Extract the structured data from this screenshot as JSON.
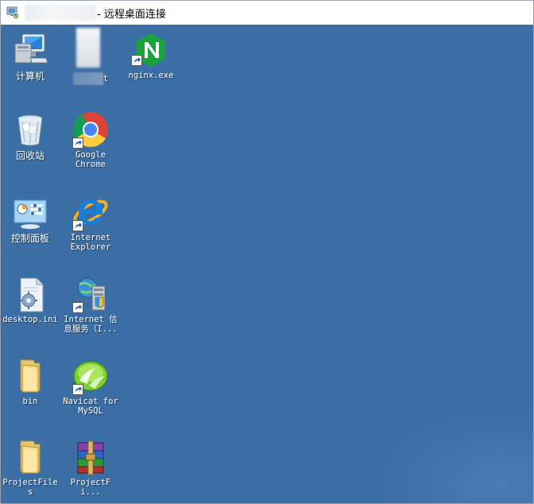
{
  "window": {
    "title": "- 远程桌面连接",
    "app_icon": "remote-desktop-icon"
  },
  "desktop": {
    "background_color": "#3b6ea5",
    "icons": [
      {
        "name": "computer",
        "label": "计算机",
        "icon": "computer-icon",
        "shortcut": false
      },
      {
        "name": "blurred-file",
        "label": "t",
        "icon": "document-icon",
        "shortcut": false
      },
      {
        "name": "nginx",
        "label": "nginx.exe",
        "icon": "nginx-icon",
        "shortcut": true
      },
      {
        "name": "recycle-bin",
        "label": "回收站",
        "icon": "recycle-bin-icon",
        "shortcut": false
      },
      {
        "name": "google-chrome",
        "label": "Google\nChrome",
        "icon": "chrome-icon",
        "shortcut": true
      },
      {
        "name": "control-panel",
        "label": "控制面板",
        "icon": "control-panel-icon",
        "shortcut": false
      },
      {
        "name": "internet-explorer",
        "label": "Internet\nExplorer",
        "icon": "ie-icon",
        "shortcut": true
      },
      {
        "name": "desktop-ini",
        "label": "desktop.ini",
        "icon": "settings-file-icon",
        "shortcut": false
      },
      {
        "name": "iis-manager",
        "label": "Internet 信\n息服务（I...",
        "icon": "iis-icon",
        "shortcut": true
      },
      {
        "name": "bin",
        "label": "bin",
        "icon": "folder-icon",
        "shortcut": false
      },
      {
        "name": "navicat",
        "label": "Navicat for\nMySQL",
        "icon": "navicat-icon",
        "shortcut": true
      },
      {
        "name": "projectfiles-folder",
        "label": "ProjectFiles",
        "icon": "folder-icon",
        "shortcut": false
      },
      {
        "name": "projectfiles-archive",
        "label": "ProjectFi...",
        "icon": "winrar-icon",
        "shortcut": false
      }
    ]
  }
}
